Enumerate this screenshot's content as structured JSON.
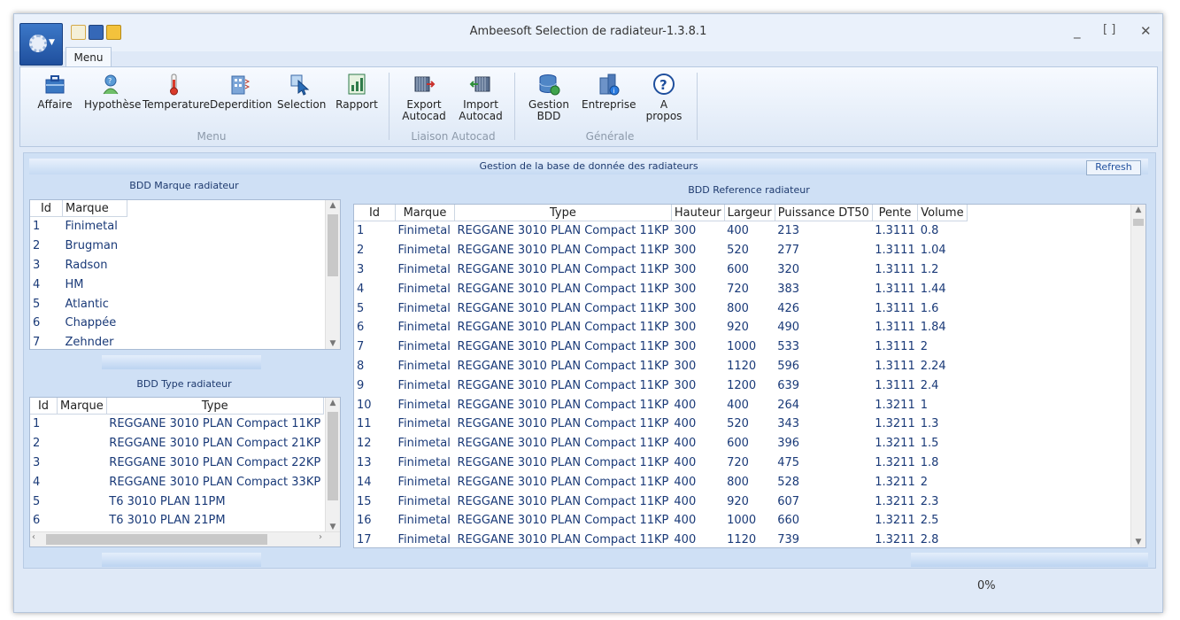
{
  "window": {
    "title": "Ambeesoft Selection de radiateur-1.3.8.1",
    "minimize": "_",
    "maximize": "[ ]",
    "close": "✕"
  },
  "ribbon": {
    "tab": "Menu",
    "groups": [
      {
        "label": "Menu",
        "buttons": [
          "Affaire",
          "Hypothèse",
          "Temperature",
          "Deperdition",
          "Selection",
          "Rapport"
        ]
      },
      {
        "label": "Liaison Autocad",
        "buttons": [
          "Export Autocad",
          "Import Autocad"
        ]
      },
      {
        "label": "Générale",
        "buttons": [
          "Gestion BDD",
          "Entreprise",
          "A propos"
        ]
      }
    ]
  },
  "main": {
    "header": "Gestion de la base de donnée des radiateurs",
    "refresh": "Refresh"
  },
  "marque_grid": {
    "caption": "BDD Marque radiateur",
    "columns": [
      "Id",
      "Marque"
    ],
    "rows": [
      [
        "1",
        "Finimetal"
      ],
      [
        "2",
        "Brugman"
      ],
      [
        "3",
        "Radson"
      ],
      [
        "4",
        "HM"
      ],
      [
        "5",
        "Atlantic"
      ],
      [
        "6",
        "Chappée"
      ],
      [
        "7",
        "Zehnder"
      ]
    ]
  },
  "type_grid": {
    "caption": "BDD Type radiateur",
    "columns": [
      "Id",
      "Marque",
      "Type"
    ],
    "rows": [
      [
        "1",
        "",
        "REGGANE 3010 PLAN Compact 11KP"
      ],
      [
        "2",
        "",
        "REGGANE 3010 PLAN Compact 21KP"
      ],
      [
        "3",
        "",
        "REGGANE 3010 PLAN Compact 22KP"
      ],
      [
        "4",
        "",
        "REGGANE 3010 PLAN Compact 33KP"
      ],
      [
        "5",
        "",
        "T6 3010 PLAN 11PM"
      ],
      [
        "6",
        "",
        "T6 3010 PLAN 21PM"
      ]
    ]
  },
  "reference_grid": {
    "caption": "BDD Reference radiateur",
    "columns": [
      "Id",
      "Marque",
      "Type",
      "Hauteur",
      "Largeur",
      "Puissance DT50",
      "Pente",
      "Volume"
    ],
    "rows": [
      [
        "1",
        "Finimetal",
        "REGGANE 3010 PLAN Compact 11KP",
        "300",
        "400",
        "213",
        "1.3111",
        "0.8"
      ],
      [
        "2",
        "Finimetal",
        "REGGANE 3010 PLAN Compact 11KP",
        "300",
        "520",
        "277",
        "1.3111",
        "1.04"
      ],
      [
        "3",
        "Finimetal",
        "REGGANE 3010 PLAN Compact 11KP",
        "300",
        "600",
        "320",
        "1.3111",
        "1.2"
      ],
      [
        "4",
        "Finimetal",
        "REGGANE 3010 PLAN Compact 11KP",
        "300",
        "720",
        "383",
        "1.3111",
        "1.44"
      ],
      [
        "5",
        "Finimetal",
        "REGGANE 3010 PLAN Compact 11KP",
        "300",
        "800",
        "426",
        "1.3111",
        "1.6"
      ],
      [
        "6",
        "Finimetal",
        "REGGANE 3010 PLAN Compact 11KP",
        "300",
        "920",
        "490",
        "1.3111",
        "1.84"
      ],
      [
        "7",
        "Finimetal",
        "REGGANE 3010 PLAN Compact 11KP",
        "300",
        "1000",
        "533",
        "1.3111",
        "2"
      ],
      [
        "8",
        "Finimetal",
        "REGGANE 3010 PLAN Compact 11KP",
        "300",
        "1120",
        "596",
        "1.3111",
        "2.24"
      ],
      [
        "9",
        "Finimetal",
        "REGGANE 3010 PLAN Compact 11KP",
        "300",
        "1200",
        "639",
        "1.3111",
        "2.4"
      ],
      [
        "10",
        "Finimetal",
        "REGGANE 3010 PLAN Compact 11KP",
        "400",
        "400",
        "264",
        "1.3211",
        "1"
      ],
      [
        "11",
        "Finimetal",
        "REGGANE 3010 PLAN Compact 11KP",
        "400",
        "520",
        "343",
        "1.3211",
        "1.3"
      ],
      [
        "12",
        "Finimetal",
        "REGGANE 3010 PLAN Compact 11KP",
        "400",
        "600",
        "396",
        "1.3211",
        "1.5"
      ],
      [
        "13",
        "Finimetal",
        "REGGANE 3010 PLAN Compact 11KP",
        "400",
        "720",
        "475",
        "1.3211",
        "1.8"
      ],
      [
        "14",
        "Finimetal",
        "REGGANE 3010 PLAN Compact 11KP",
        "400",
        "800",
        "528",
        "1.3211",
        "2"
      ],
      [
        "15",
        "Finimetal",
        "REGGANE 3010 PLAN Compact 11KP",
        "400",
        "920",
        "607",
        "1.3211",
        "2.3"
      ],
      [
        "16",
        "Finimetal",
        "REGGANE 3010 PLAN Compact 11KP",
        "400",
        "1000",
        "660",
        "1.3211",
        "2.5"
      ],
      [
        "17",
        "Finimetal",
        "REGGANE 3010 PLAN Compact 11KP",
        "400",
        "1120",
        "739",
        "1.3211",
        "2.8"
      ]
    ]
  },
  "status": {
    "progress": "0%",
    "progress_value": 0
  },
  "colors": {
    "accent": "#1f4f9d",
    "cell_text": "#1a3a78",
    "panel_bg": "#cfe0f5"
  }
}
